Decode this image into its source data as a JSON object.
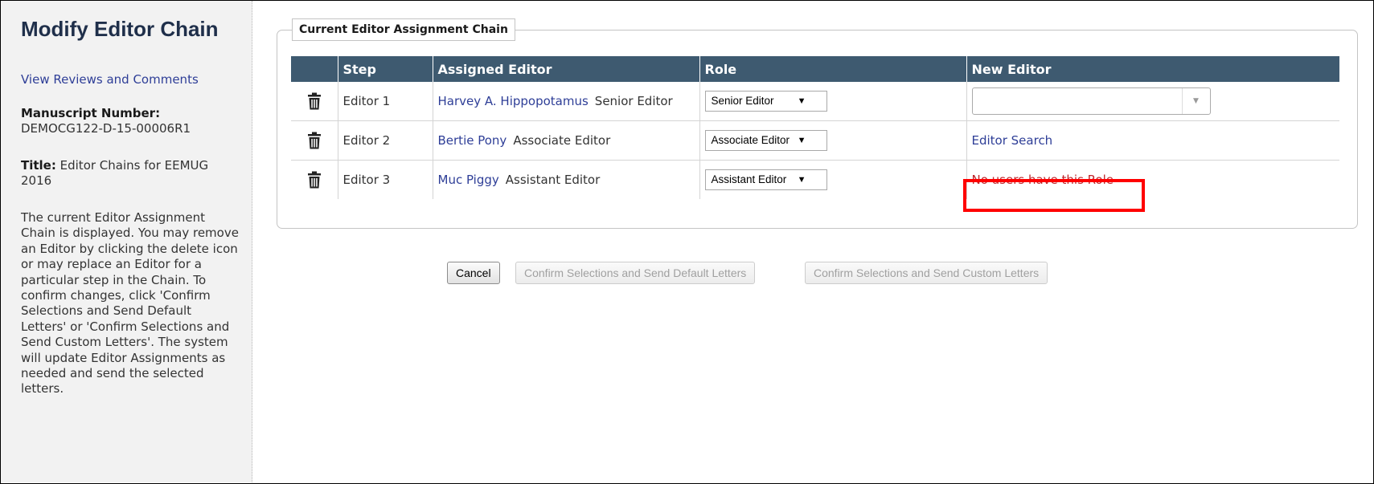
{
  "sidebar": {
    "title": "Modify Editor Chain",
    "view_reviews_link": "View Reviews and Comments",
    "manuscript_label": "Manuscript Number:",
    "manuscript_number": "DEMOCG122-D-15-00006R1",
    "title_label": "Title:",
    "title_value": "Editor Chains for EEMUG 2016",
    "help_text": "The current Editor Assignment Chain is displayed. You may remove an Editor by clicking the delete icon or may replace an Editor for a particular step in the Chain. To confirm changes, click 'Confirm Selections and Send Default Letters' or 'Confirm Selections and Send Custom Letters'. The system will update Editor Assignments as needed and send the selected letters."
  },
  "chain": {
    "legend": "Current Editor Assignment Chain",
    "columns": [
      "",
      "Step",
      "Assigned Editor",
      "Role",
      "New Editor"
    ],
    "rows": [
      {
        "step": "Editor 1",
        "editor_name": "Harvey A. Hippopotamus",
        "editor_role": "Senior Editor",
        "role_select": "Senior Editor",
        "new_editor_value": ""
      },
      {
        "step": "Editor 2",
        "editor_name": "Bertie Pony",
        "editor_role": "Associate Editor",
        "role_select": "Associate Editor",
        "new_editor_link": "Editor Search"
      },
      {
        "step": "Editor 3",
        "editor_name": "Muc Piggy",
        "editor_role": "Assistant Editor",
        "role_select": "Assistant Editor",
        "new_editor_message": "No users have this Role"
      }
    ]
  },
  "buttons": {
    "cancel": "Cancel",
    "confirm_default": "Confirm Selections and Send Default Letters",
    "confirm_custom": "Confirm Selections and Send Custom Letters"
  },
  "icons": {
    "delete": "trash-icon",
    "dropdown": "chevron-down-icon"
  },
  "colors": {
    "header_bg": "#3e5a70",
    "link": "#2e3e97",
    "warning_text": "#c0272d",
    "highlight_border": "#ff0000"
  }
}
